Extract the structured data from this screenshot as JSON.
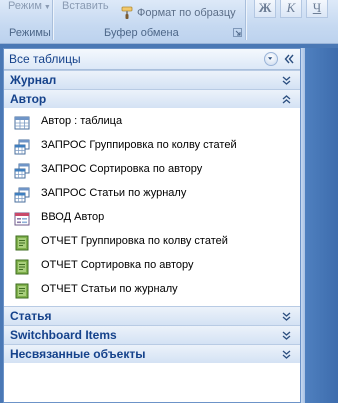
{
  "ribbon": {
    "regime_button": "Режим",
    "paste_button": "Вставить",
    "format_painter": "Формат по образцу",
    "group_regimes": "Режимы",
    "group_clipboard": "Буфер обмена",
    "bold": "Ж",
    "italic": "К",
    "underline": "Ч"
  },
  "nav": {
    "title": "Все таблицы",
    "groups": [
      {
        "label": "Журнал",
        "state": "collapsed"
      },
      {
        "label": "Автор",
        "state": "expanded"
      },
      {
        "label": "Статья",
        "state": "collapsed"
      },
      {
        "label": "Switchboard Items",
        "state": "collapsed"
      },
      {
        "label": "Несвязанные объекты",
        "state": "collapsed"
      }
    ],
    "author_items": [
      {
        "icon": "table-icon",
        "label": "Автор : таблица"
      },
      {
        "icon": "query-icon",
        "label": "ЗАПРОС Группировка по колву статей"
      },
      {
        "icon": "query-icon",
        "label": "ЗАПРОС Сортировка по автору"
      },
      {
        "icon": "query-icon",
        "label": "ЗАПРОС Статьи по журналу"
      },
      {
        "icon": "form-icon",
        "label": "ВВОД Автор"
      },
      {
        "icon": "report-icon",
        "label": "ОТЧЕТ Группировка по колву статей"
      },
      {
        "icon": "report-icon",
        "label": "ОТЧЕТ Сортировка по автору"
      },
      {
        "icon": "report-icon",
        "label": "ОТЧЕТ Статьи по журналу"
      }
    ]
  },
  "colors": {
    "accent": "#15428b",
    "header_bg": "#d4e2f4",
    "app_bg": "#4a78b5"
  }
}
